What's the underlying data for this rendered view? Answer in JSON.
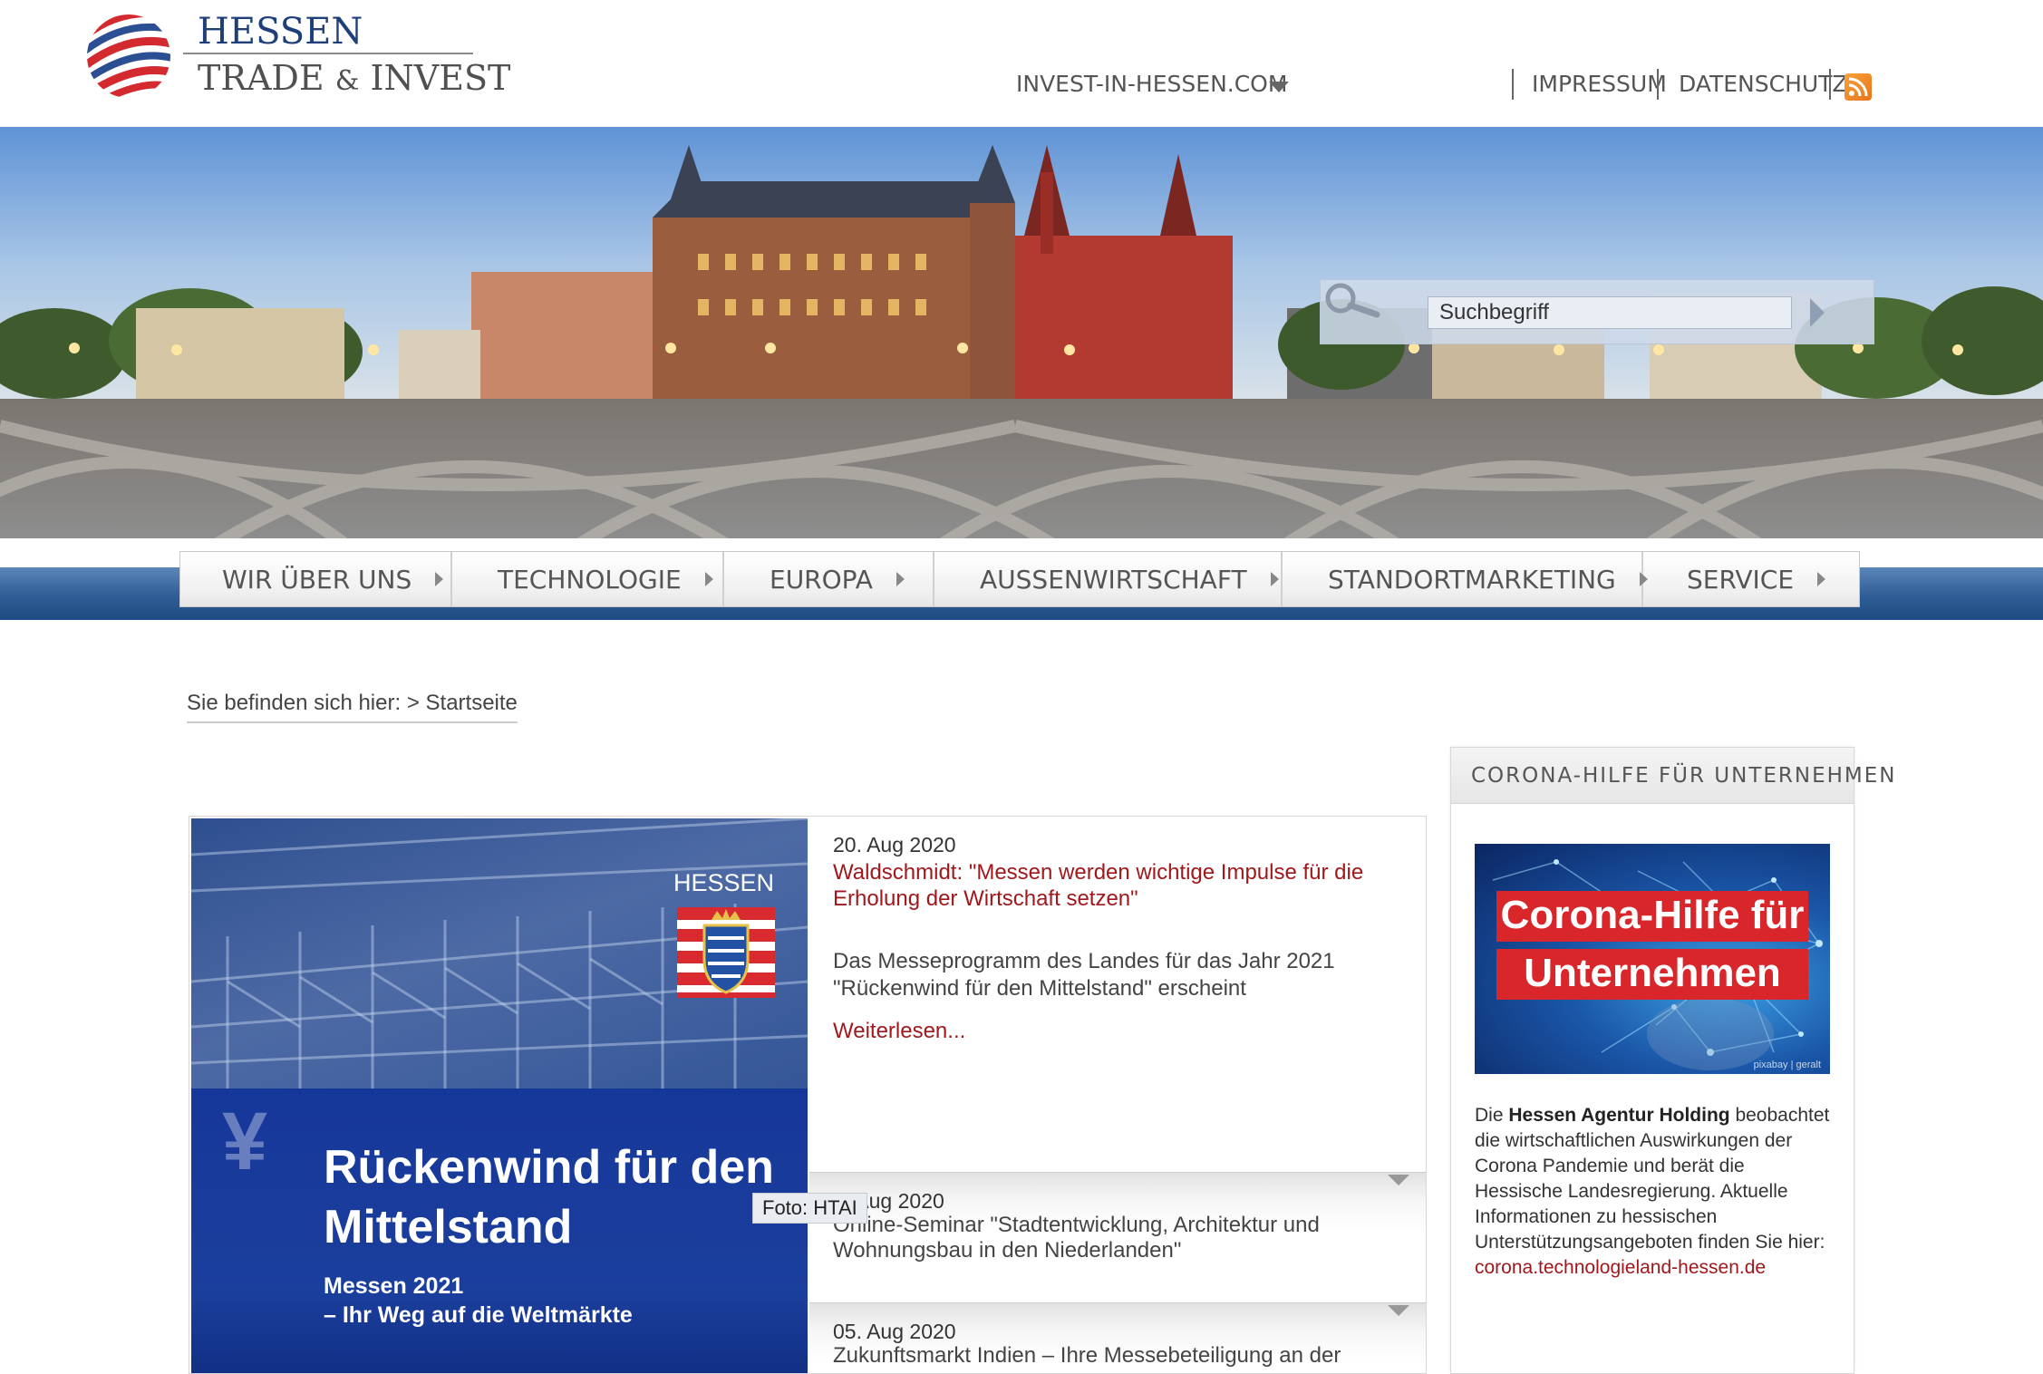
{
  "header": {
    "logo": {
      "line1": "HESSEN",
      "line2_a": "TRADE",
      "line2_amp": "&",
      "line2_b": "INVEST"
    },
    "top_links": {
      "invest": "INVEST-IN-HESSEN.COM",
      "impressum": "IMPRESSUM",
      "datenschutz": "DATENSCHUTZ"
    },
    "icons": {
      "rss": "rss-icon",
      "dropdown": "chevron-down-icon"
    }
  },
  "search": {
    "placeholder": "Suchbegriff",
    "value": "Suchbegriff"
  },
  "nav": {
    "items": [
      {
        "label": "WIR ÜBER UNS"
      },
      {
        "label": "TECHNOLOGIE"
      },
      {
        "label": "EUROPA"
      },
      {
        "label": "AUSSENWIRTSCHAFT"
      },
      {
        "label": "STANDORTMARKETING"
      },
      {
        "label": "SERVICE"
      }
    ]
  },
  "breadcrumb": {
    "prefix": "Sie befinden sich hier:",
    "separator": ">",
    "current": "Startseite"
  },
  "news": {
    "featured": {
      "date": "20. Aug 2020",
      "title": "Waldschmidt: \"Messen werden wichtige Impulse für die Erholung der Wirtschaft setzen\"",
      "teaser": "Das Messeprogramm des Landes für das Jahr 2021 \"Rückenwind für den Mittelstand\" erscheint",
      "more": "Weiterlesen...",
      "image": {
        "brand": "HESSEN",
        "headline": "Rückenwind für den Mittelstand",
        "subline_1": "Messen 2021",
        "subline_2": "– Ihr Weg auf die Weltmärkte"
      },
      "photo_credit": "Foto: HTAI"
    },
    "items": [
      {
        "date": "... Aug 2020",
        "title": "Online-Seminar \"Stadtentwicklung, Architektur und Wohnungsbau in den Niederlanden\""
      },
      {
        "date": "05. Aug 2020",
        "title": "Zukunftsmarkt Indien – Ihre Messebeteiligung an der"
      }
    ]
  },
  "sidebar": {
    "title": "CORONA-HILFE FÜR UNTERNEHMEN",
    "image": {
      "line1": "Corona-Hilfe für",
      "line2": "Unternehmen",
      "credit": "pixabay | geralt"
    },
    "text_intro": "Die",
    "text_bold": "Hessen Agentur Holding",
    "text_body": "beobachtet die wirtschaftlichen Auswirkungen der Corona Pandemie und berät die Hessische Landesregierung. Aktuelle Informationen zu hessischen Unterstützungsangeboten finden Sie hier:",
    "link": "corona.technologieland-hessen.de"
  },
  "colors": {
    "brand_blue": "#1f3f7a",
    "link_red": "#a0181c",
    "nav_blue": "#2e5d95"
  }
}
